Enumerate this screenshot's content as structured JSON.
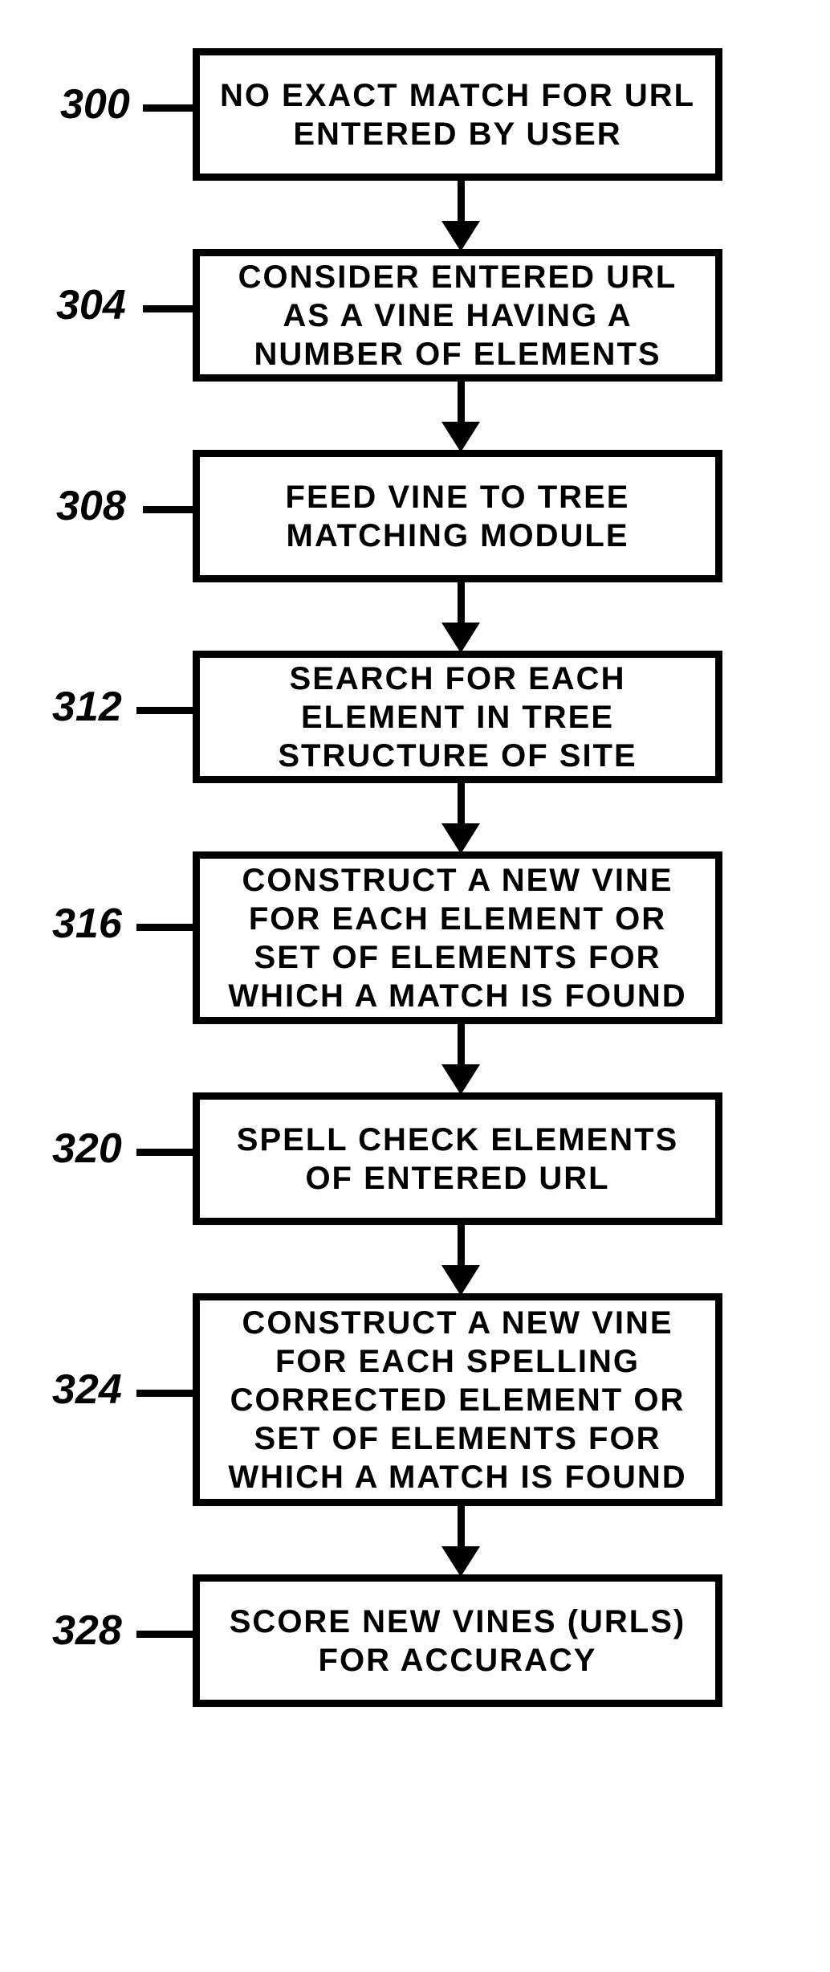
{
  "chart_data": {
    "type": "flowchart",
    "nodes": [
      {
        "id": "300",
        "label": "NO EXACT MATCH FOR URL ENTERED BY USER"
      },
      {
        "id": "304",
        "label": "CONSIDER ENTERED URL AS A VINE HAVING A NUMBER OF ELEMENTS"
      },
      {
        "id": "308",
        "label": "FEED VINE TO TREE MATCHING MODULE"
      },
      {
        "id": "312",
        "label": "SEARCH FOR EACH ELEMENT IN TREE STRUCTURE OF SITE"
      },
      {
        "id": "316",
        "label": "CONSTRUCT A NEW VINE FOR EACH ELEMENT OR SET OF ELEMENTS FOR WHICH A MATCH IS FOUND"
      },
      {
        "id": "320",
        "label": "SPELL CHECK ELEMENTS OF ENTERED URL"
      },
      {
        "id": "324",
        "label": "CONSTRUCT A NEW VINE FOR EACH SPELLING CORRECTED ELEMENT OR SET OF ELEMENTS FOR WHICH A MATCH IS FOUND"
      },
      {
        "id": "328",
        "label": "SCORE NEW VINES (URLS) FOR ACCURACY"
      }
    ],
    "edges": [
      [
        "300",
        "304"
      ],
      [
        "304",
        "308"
      ],
      [
        "308",
        "312"
      ],
      [
        "312",
        "316"
      ],
      [
        "316",
        "320"
      ],
      [
        "320",
        "324"
      ],
      [
        "324",
        "328"
      ]
    ]
  }
}
